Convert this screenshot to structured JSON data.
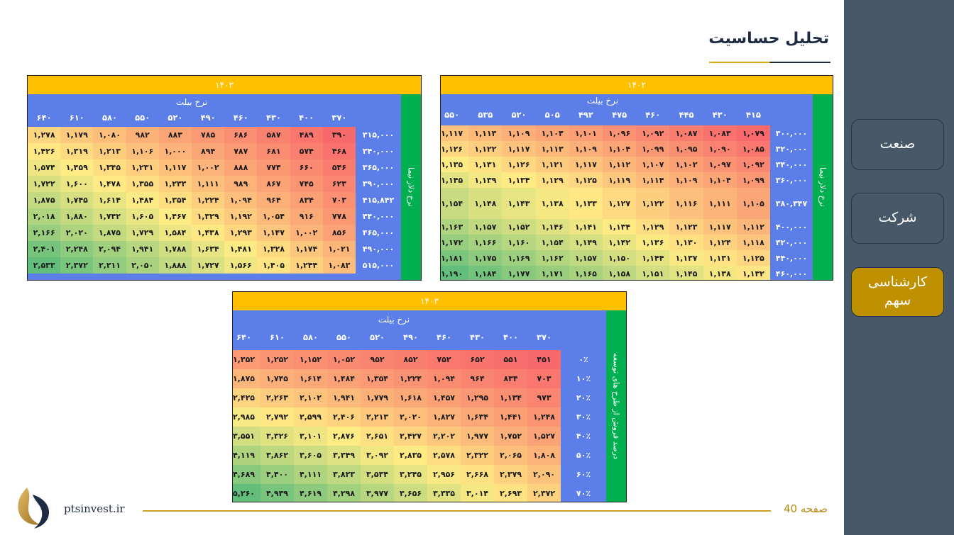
{
  "header": {
    "title": "تحلیل حساسیت"
  },
  "sidebar": {
    "items": [
      {
        "label": "صنعت"
      },
      {
        "label": "شرکت"
      },
      {
        "label": "کارشناسی\nسهم"
      }
    ]
  },
  "footer": {
    "site": "ptsinvest.ir",
    "page": "صفحه 40"
  },
  "colors": {
    "year_bar": "#fec000",
    "side_bar": "#00b050",
    "header_blue": "#5b7ee8",
    "sidebar_bg": "#475868",
    "active_nav": "#bf9000",
    "heat_low": "#f8696b",
    "heat_mid": "#ffeb84",
    "heat_high": "#63be7b"
  },
  "panels": [
    {
      "id": "p1402",
      "year": "۱۴۰۲",
      "ticket_label": "نرخ بیلت",
      "side_label": "نرخ دلار نیما",
      "cols": [
        "۴۱۵",
        "۴۳۰",
        "۴۴۵",
        "۴۶۰",
        "۴۷۵",
        "۴۹۲",
        "۵۰۵",
        "۵۲۰",
        "۵۳۵",
        "۵۵۰"
      ],
      "rows": [
        {
          "label": "۳۰۰,۰۰۰",
          "values": [
            "۱,۰۷۹",
            "۱,۰۸۳",
            "۱,۰۸۷",
            "۱,۰۹۲",
            "۱,۰۹۶",
            "۱,۱۰۱",
            "۱,۱۰۴",
            "۱,۱۰۹",
            "۱,۱۱۳",
            "۱,۱۱۷"
          ]
        },
        {
          "label": "۳۲۰,۰۰۰",
          "values": [
            "۱,۰۸۵",
            "۱,۰۹۰",
            "۱,۰۹۵",
            "۱,۰۹۹",
            "۱,۱۰۴",
            "۱,۱۰۹",
            "۱,۱۱۳",
            "۱,۱۱۷",
            "۱,۱۲۲",
            "۱,۱۲۶"
          ]
        },
        {
          "label": "۳۴۰,۰۰۰",
          "values": [
            "۱,۰۹۲",
            "۱,۰۹۷",
            "۱,۱۰۲",
            "۱,۱۰۷",
            "۱,۱۱۲",
            "۱,۱۱۷",
            "۱,۱۲۱",
            "۱,۱۲۶",
            "۱,۱۳۱",
            "۱,۱۳۵"
          ]
        },
        {
          "label": "۳۶۰,۰۰۰",
          "values": [
            "۱,۰۹۹",
            "۱,۱۰۴",
            "۱,۱۰۹",
            "۱,۱۱۴",
            "۱,۱۱۹",
            "۱,۱۲۵",
            "۱,۱۲۹",
            "۱,۱۳۴",
            "۱,۱۳۹",
            "۱,۱۴۵"
          ]
        },
        {
          "label": "۳۸۰,۳۴۷",
          "values": [
            "۱,۱۰۵",
            "۱,۱۱۱",
            "۱,۱۱۶",
            "۱,۱۲۲",
            "۱,۱۲۷",
            "۱,۱۳۳",
            "۱,۱۳۸",
            "۱,۱۴۳",
            "۱,۱۴۸",
            "۱,۱۵۴"
          ]
        },
        {
          "label": "۴۰۰,۰۰۰",
          "values": [
            "۱,۱۱۲",
            "۱,۱۱۷",
            "۱,۱۲۳",
            "۱,۱۲۹",
            "۱,۱۳۴",
            "۱,۱۴۱",
            "۱,۱۴۶",
            "۱,۱۵۲",
            "۱,۱۵۷",
            "۱,۱۶۳"
          ]
        },
        {
          "label": "۴۲۰,۰۰۰",
          "values": [
            "۱,۱۱۸",
            "۱,۱۲۴",
            "۱,۱۳۰",
            "۱,۱۳۶",
            "۱,۱۴۲",
            "۱,۱۴۹",
            "۱,۱۵۴",
            "۱,۱۶۰",
            "۱,۱۶۶",
            "۱,۱۷۲"
          ]
        },
        {
          "label": "۴۴۰,۰۰۰",
          "values": [
            "۱,۱۲۵",
            "۱,۱۳۱",
            "۱,۱۳۷",
            "۱,۱۴۴",
            "۱,۱۵۰",
            "۱,۱۵۷",
            "۱,۱۶۲",
            "۱,۱۶۹",
            "۱,۱۷۵",
            "۱,۱۸۱"
          ]
        },
        {
          "label": "۴۶۰,۰۰۰",
          "values": [
            "۱,۱۳۲",
            "۱,۱۳۸",
            "۱,۱۴۵",
            "۱,۱۵۱",
            "۱,۱۵۸",
            "۱,۱۶۵",
            "۱,۱۷۱",
            "۱,۱۷۷",
            "۱,۱۸۴",
            "۱,۱۹۰"
          ]
        }
      ]
    },
    {
      "id": "p1403a",
      "year": "۱۴۰۳",
      "ticket_label": "نرخ بیلت",
      "side_label": "نرخ دلار نیما",
      "cols": [
        "۳۷۰",
        "۴۰۰",
        "۴۳۰",
        "۴۶۰",
        "۴۹۰",
        "۵۲۰",
        "۵۵۰",
        "۵۸۰",
        "۶۱۰",
        "۶۴۰"
      ],
      "rows": [
        {
          "label": "۳۱۵,۰۰۰",
          "values": [
            "۳۹۰",
            "۴۸۹",
            "۵۸۷",
            "۶۸۶",
            "۷۸۵",
            "۸۸۳",
            "۹۸۲",
            "۱,۰۸۰",
            "۱,۱۷۹",
            "۱,۲۷۸"
          ]
        },
        {
          "label": "۳۴۰,۰۰۰",
          "values": [
            "۴۶۸",
            "۵۷۴",
            "۶۸۱",
            "۷۸۷",
            "۸۹۴",
            "۱,۰۰۰",
            "۱,۱۰۶",
            "۱,۲۱۳",
            "۱,۳۱۹",
            "۱,۴۲۶"
          ]
        },
        {
          "label": "۳۶۵,۰۰۰",
          "values": [
            "۵۴۶",
            "۶۶۰",
            "۷۷۴",
            "۸۸۸",
            "۱,۰۰۲",
            "۱,۱۱۷",
            "۱,۲۳۱",
            "۱,۳۴۵",
            "۱,۴۵۹",
            "۱,۵۷۴"
          ]
        },
        {
          "label": "۳۹۰,۰۰۰",
          "values": [
            "۶۲۳",
            "۷۴۵",
            "۸۶۷",
            "۹۸۹",
            "۱,۱۱۱",
            "۱,۲۳۳",
            "۱,۳۵۵",
            "۱,۴۷۸",
            "۱,۶۰۰",
            "۱,۷۲۲"
          ]
        },
        {
          "label": "۴۱۵,۸۴۲",
          "values": [
            "۷۰۳",
            "۸۳۴",
            "۹۶۴",
            "۱,۰۹۴",
            "۱,۲۲۴",
            "۱,۳۵۴",
            "۱,۴۸۴",
            "۱,۶۱۴",
            "۱,۷۴۵",
            "۱,۸۷۵"
          ]
        },
        {
          "label": "۴۴۰,۰۰۰",
          "values": [
            "۷۷۸",
            "۹۱۶",
            "۱,۰۵۴",
            "۱,۱۹۲",
            "۱,۳۲۹",
            "۱,۴۶۷",
            "۱,۶۰۵",
            "۱,۷۴۲",
            "۱,۸۸۰",
            "۲,۰۱۸"
          ]
        },
        {
          "label": "۴۶۵,۰۰۰",
          "values": [
            "۸۵۶",
            "۱,۰۰۲",
            "۱,۱۴۷",
            "۱,۲۹۳",
            "۱,۴۳۸",
            "۱,۵۸۴",
            "۱,۷۲۹",
            "۱,۸۷۵",
            "۲,۰۲۰",
            "۲,۱۶۶"
          ]
        },
        {
          "label": "۴۹۰,۰۰۰",
          "values": [
            "۱,۰۲۱",
            "۱,۱۷۴",
            "۱,۳۲۸",
            "۱,۴۸۱",
            "۱,۶۳۴",
            "۱,۷۸۸",
            "۱,۹۴۱",
            "۲,۰۹۴",
            "۲,۲۴۸",
            "۲,۴۰۱"
          ]
        },
        {
          "label": "۵۱۵,۰۰۰",
          "values": [
            "۱,۰۸۳",
            "۱,۲۴۴",
            "۱,۴۰۵",
            "۱,۵۶۶",
            "۱,۷۲۷",
            "۱,۸۸۸",
            "۲,۰۵۰",
            "۲,۲۱۱",
            "۲,۳۷۲",
            "۲,۵۳۳"
          ]
        }
      ]
    },
    {
      "id": "p1403b",
      "year": "۱۴۰۳",
      "ticket_label": "نرخ بیلت",
      "side_label": "درصد فروش از طرح های توسعه",
      "cols": [
        "۳۷۰",
        "۴۰۰",
        "۴۳۰",
        "۴۶۰",
        "۴۹۰",
        "۵۲۰",
        "۵۵۰",
        "۵۸۰",
        "۶۱۰",
        "۶۴۰"
      ],
      "rows": [
        {
          "label": "۰٪",
          "values": [
            "۴۵۱",
            "۵۵۱",
            "۶۵۲",
            "۷۵۲",
            "۸۵۲",
            "۹۵۲",
            "۱,۰۵۲",
            "۱,۱۵۲",
            "۱,۲۵۲",
            "۱,۳۵۲"
          ]
        },
        {
          "label": "۱۰٪",
          "values": [
            "۷۰۳",
            "۸۳۴",
            "۹۶۴",
            "۱,۰۹۴",
            "۱,۲۲۴",
            "۱,۳۵۴",
            "۱,۴۸۴",
            "۱,۶۱۴",
            "۱,۷۴۵",
            "۱,۸۷۵"
          ]
        },
        {
          "label": "۲۰٪",
          "values": [
            "۹۷۳",
            "۱,۱۳۴",
            "۱,۲۹۵",
            "۱,۴۵۷",
            "۱,۶۱۸",
            "۱,۷۷۹",
            "۱,۹۴۱",
            "۲,۱۰۲",
            "۲,۲۶۳",
            "۲,۴۲۵"
          ]
        },
        {
          "label": "۳۰٪",
          "values": [
            "۱,۲۴۸",
            "۱,۴۴۱",
            "۱,۶۳۴",
            "۱,۸۲۷",
            "۲,۰۲۰",
            "۲,۲۱۳",
            "۲,۴۰۶",
            "۲,۵۹۹",
            "۲,۷۹۲",
            "۲,۹۸۵"
          ]
        },
        {
          "label": "۴۰٪",
          "values": [
            "۱,۵۲۷",
            "۱,۷۵۲",
            "۱,۹۷۷",
            "۲,۲۰۲",
            "۲,۴۲۷",
            "۲,۶۵۱",
            "۲,۸۷۶",
            "۳,۱۰۱",
            "۳,۳۲۶",
            "۳,۵۵۱"
          ]
        },
        {
          "label": "۵۰٪",
          "values": [
            "۱,۸۰۸",
            "۲,۰۶۵",
            "۲,۳۲۲",
            "۲,۵۷۸",
            "۲,۸۳۵",
            "۳,۰۹۲",
            "۳,۳۴۹",
            "۳,۶۰۵",
            "۳,۸۶۲",
            "۴,۱۱۹"
          ]
        },
        {
          "label": "۶۰٪",
          "values": [
            "۲,۰۹۰",
            "۲,۳۷۹",
            "۲,۶۶۸",
            "۲,۹۵۶",
            "۳,۲۴۵",
            "۳,۵۳۴",
            "۳,۸۲۳",
            "۴,۱۱۱",
            "۴,۴۰۰",
            "۴,۶۸۹"
          ]
        },
        {
          "label": "۷۰٪",
          "values": [
            "۲,۳۷۲",
            "۲,۶۹۳",
            "۳,۰۱۴",
            "۳,۳۳۵",
            "۳,۶۵۶",
            "۳,۹۷۷",
            "۴,۲۹۸",
            "۴,۶۱۹",
            "۴,۹۳۹",
            "۵,۲۶۰"
          ]
        }
      ]
    }
  ]
}
